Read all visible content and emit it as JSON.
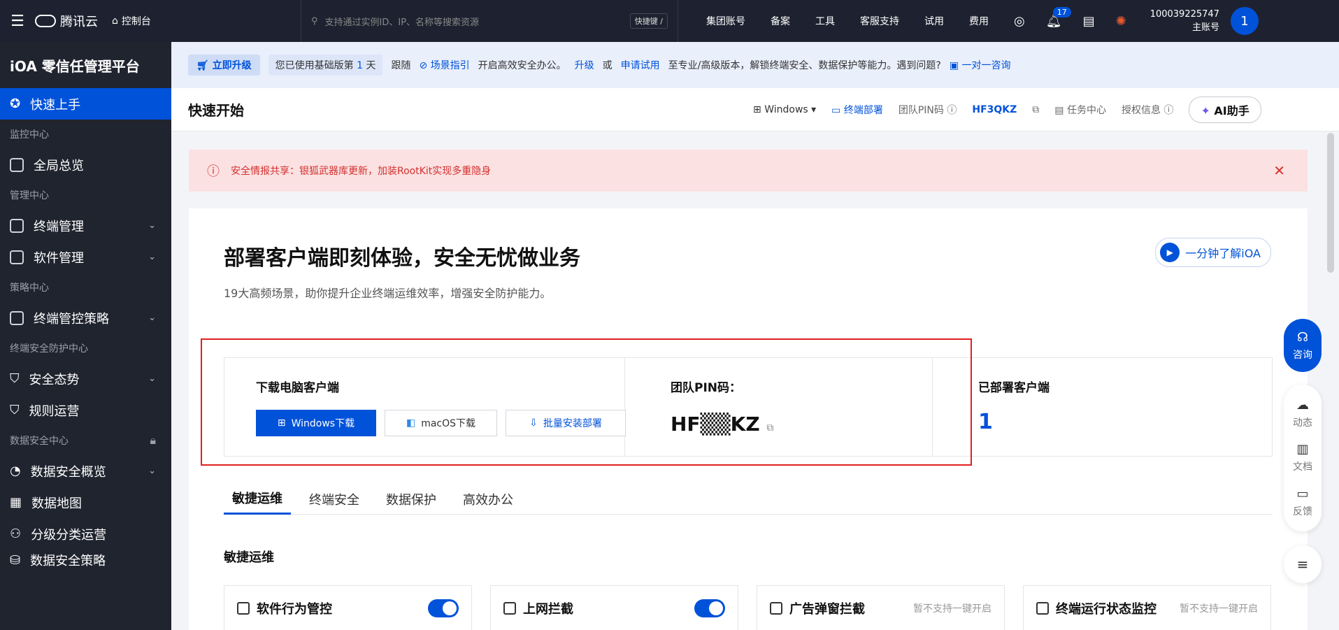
{
  "topbar": {
    "brand": "腾讯云",
    "console": "控制台",
    "search_placeholder": "支持通过实例ID、IP、名称等搜索资源",
    "shortcut": "快捷键 /",
    "nav": [
      "集团账号",
      "备案",
      "工具",
      "客服支持",
      "试用",
      "费用"
    ],
    "notify_count": "17",
    "account_id": "100039225747",
    "account_role": "主账号",
    "avatar": "1"
  },
  "sidebar": {
    "title": "iOA 零信任管理平台",
    "quick_start": "快速上手",
    "g_monitor": "监控中心",
    "overview": "全局总览",
    "g_manage": "管理中心",
    "terminal_mgmt": "终端管理",
    "software_mgmt": "软件管理",
    "g_policy": "策略中心",
    "terminal_policy": "终端管控策略",
    "g_protect": "终端安全防护中心",
    "security_posture": "安全态势",
    "rule_ops": "规则运营",
    "g_data": "数据安全中心",
    "data_overview": "数据安全概览",
    "data_map": "数据地图",
    "classify_ops": "分级分类运营",
    "data_policy": "数据安全策略"
  },
  "banner": {
    "upgrade": "立即升级",
    "used_prefix": "您已使用基础版第",
    "used_days": "1",
    "used_suffix": "天",
    "follow": "跟随",
    "guide": "场景指引",
    "text1": "开启高效安全办公。",
    "upgrade_link": "升级",
    "or": "或",
    "trial_link": "申请试用",
    "text2": "至专业/高级版本，解锁终端安全、数据保护等能力。遇到问题?",
    "consult": "一对一咨询"
  },
  "header": {
    "title": "快速开始",
    "os": "Windows",
    "deploy": "终端部署",
    "pin_label": "团队PIN码",
    "pin_value": "HF3QKZ",
    "tasks": "任务中心",
    "license": "授权信息",
    "ai": "AI助手"
  },
  "alert": {
    "text": "安全情报共享：银狐武器库更新，加装RootKit实现多重隐身"
  },
  "hero": {
    "title": "部署客户端即刻体验，安全无忧做业务",
    "subtitle": "19大高频场景，助你提升企业终端运维效率，增强安全防护能力。",
    "video": "一分钟了解iOA"
  },
  "cards": {
    "download_title": "下载电脑客户端",
    "win_btn": "Windows下载",
    "mac_btn": "macOS下载",
    "batch_btn": "批量安装部署",
    "pin_title": "团队PIN码：",
    "pin_masked": "HF▒▒KZ",
    "deployed_title": "已部署客户端",
    "deployed_count": "1"
  },
  "tabs": [
    "敏捷运维",
    "终端安全",
    "数据保护",
    "高效办公"
  ],
  "section_title": "敏捷运维",
  "features": [
    {
      "name": "软件行为管控",
      "note": ""
    },
    {
      "name": "上网拦截",
      "note": ""
    },
    {
      "name": "广告弹窗拦截",
      "note": "暂不支持一键开启"
    },
    {
      "name": "终端运行状态监控",
      "note": "暂不支持一键开启"
    }
  ],
  "float": {
    "consult": "咨询",
    "news": "动态",
    "docs": "文档",
    "feedback": "反馈"
  },
  "colors": {
    "primary": "#0052d9",
    "topbar": "#1e2230",
    "sidebar": "#20242f",
    "alert_bg": "#fbe1e1",
    "alert_text": "#d43030",
    "highlight": "#e02020"
  }
}
